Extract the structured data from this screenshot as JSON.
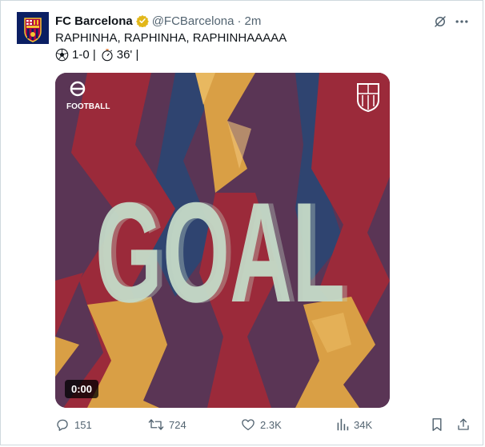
{
  "tweet": {
    "author_name": "FC Barcelona",
    "handle": "@FCBarcelona",
    "separator": "·",
    "time": "2m",
    "text_line1": "RAPHINHA, RAPHINHA, RAPHINHAAAAA",
    "score_text": "1-0 |",
    "minute_text": "36' |",
    "icons": {
      "verified": "verified-gold-badge-icon",
      "grok": "grok-icon",
      "more": "more-dots-icon",
      "ball": "soccer-ball-icon",
      "stopwatch": "stopwatch-icon"
    }
  },
  "media": {
    "brand_logo_text": "FOOTBALL",
    "headline": "GOAL",
    "video_time": "0:00",
    "colors": {
      "background": "#5a3555",
      "red": "#9b2a3a",
      "gold": "#d99f45",
      "blue": "#2f4470",
      "headline": "#c4d9c7"
    }
  },
  "actions": {
    "replies": "151",
    "reposts": "724",
    "likes": "2.3K",
    "views": "34K"
  },
  "colors": {
    "text": "#0f1419",
    "secondary": "#536471",
    "verified": "#e2b719",
    "border": "#cfd9de"
  }
}
